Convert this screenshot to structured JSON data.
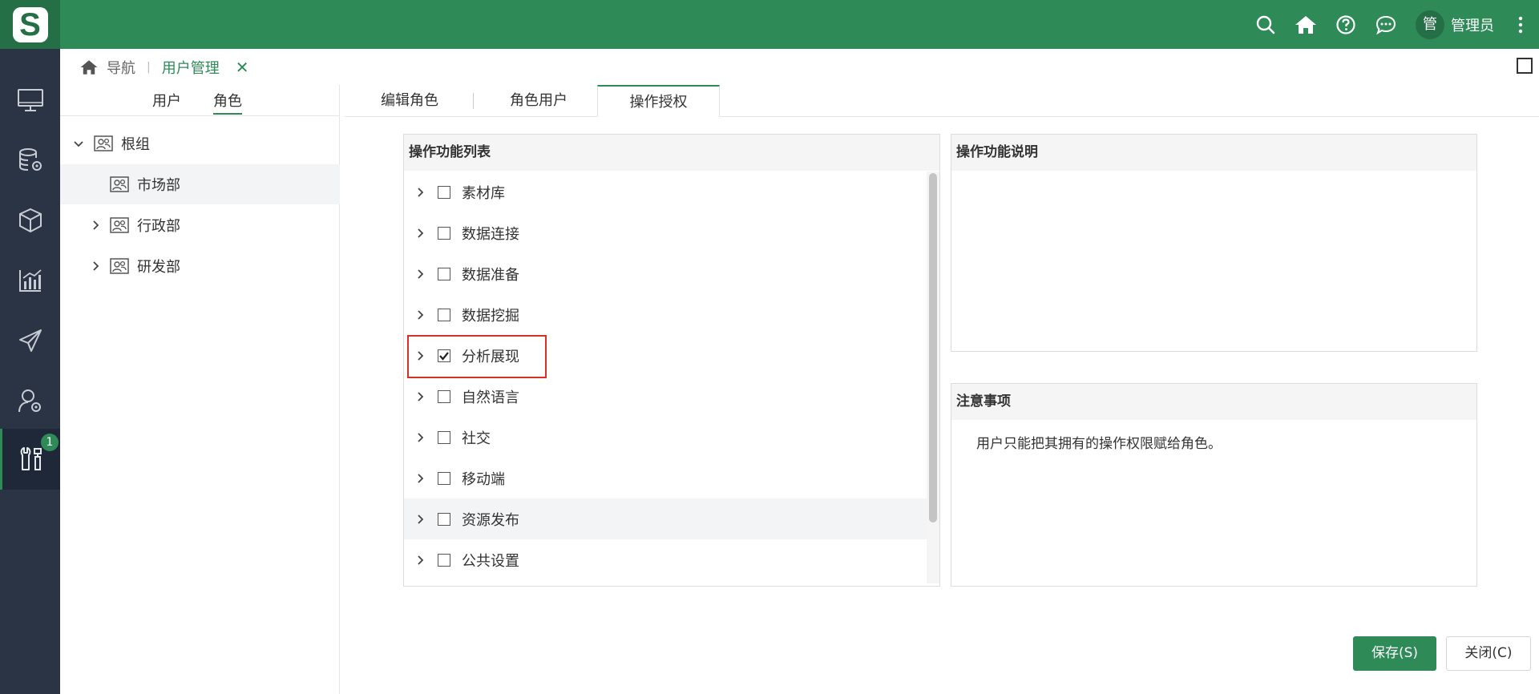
{
  "topbar": {
    "logo_letter": "S",
    "icons": [
      "search-icon",
      "home-icon",
      "help-icon",
      "chat-icon"
    ],
    "avatar_text": "管",
    "user_name": "管理员"
  },
  "leftnav": {
    "items": [
      "monitor-icon",
      "database-gear-icon",
      "cube-icon",
      "chart-icon",
      "paper-plane-icon",
      "user-gear-icon",
      "tools-icon"
    ],
    "active_index": 6,
    "badge_count": "1"
  },
  "breadcrumb": {
    "nav_label": "导航",
    "current_label": "用户管理",
    "close_glyph": "✕"
  },
  "left_panel": {
    "tabs": [
      "用户",
      "角色"
    ],
    "active_tab": 1,
    "tree": [
      {
        "label": "根组",
        "expanded": true
      },
      {
        "label": "市场部",
        "selected": true
      },
      {
        "label": "行政部",
        "expanded": false
      },
      {
        "label": "研发部",
        "expanded": false
      }
    ]
  },
  "right_tabs": {
    "items": [
      "编辑角色",
      "角色用户",
      "操作授权"
    ],
    "active_index": 2
  },
  "operation_list": {
    "title": "操作功能列表",
    "items": [
      {
        "label": "素材库",
        "checked": false
      },
      {
        "label": "数据连接",
        "checked": false
      },
      {
        "label": "数据准备",
        "checked": false
      },
      {
        "label": "数据挖掘",
        "checked": false
      },
      {
        "label": "分析展现",
        "checked": true
      },
      {
        "label": "自然语言",
        "checked": false
      },
      {
        "label": "社交",
        "checked": false
      },
      {
        "label": "移动端",
        "checked": false
      },
      {
        "label": "资源发布",
        "checked": false
      },
      {
        "label": "公共设置",
        "checked": false
      }
    ]
  },
  "description_panel": {
    "title": "操作功能说明"
  },
  "notes_panel": {
    "title": "注意事项",
    "text": "用户只能把其拥有的操作权限赋给角色。"
  },
  "buttons": {
    "save_label": "保存(S)",
    "close_label": "关闭(C)"
  },
  "colors": {
    "brand": "#2e8b57",
    "nav_bg": "#2b3445",
    "highlight": "#d93025"
  }
}
